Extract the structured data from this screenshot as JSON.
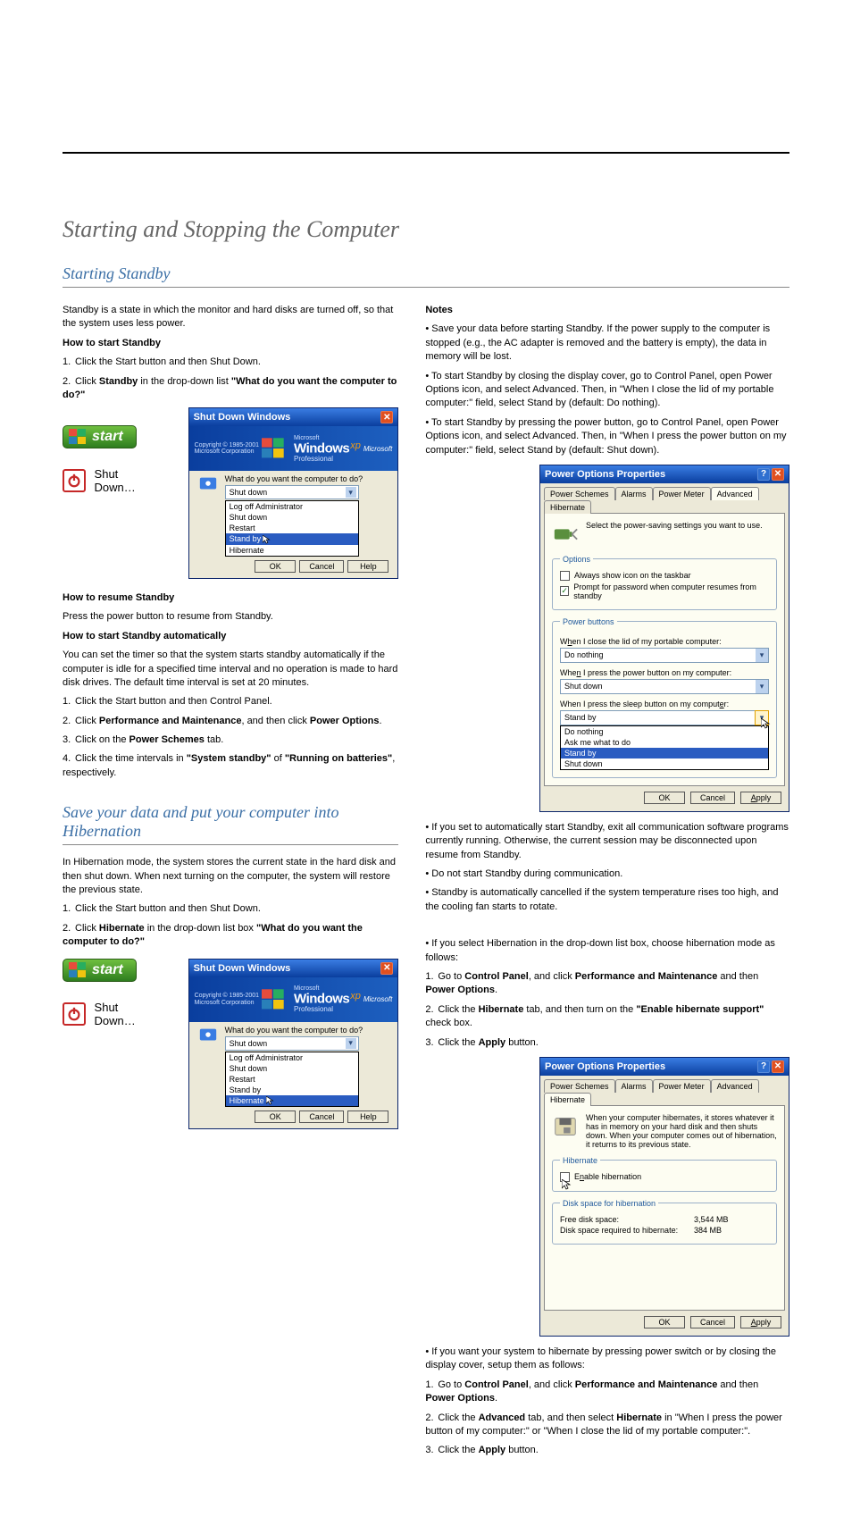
{
  "page": {
    "section_heading": "Starting and Stopping the Computer",
    "subtitle_standby": "Starting Standby",
    "subtitle_hibernate": "Save your data and put your computer into Hibernation"
  },
  "standby": {
    "intro": "Standby is a state in which the monitor and hard disks are turned off, so that the system uses less power.",
    "how_to_heading": "How to start Standby",
    "step1": "Click the Start button and then Shut Down.",
    "step2_a": "Click ",
    "step2_b": "Standby",
    "step2_c": " in the drop-down list ",
    "step2_d": "\"What do you want the computer to do?\"",
    "resume_heading": "How to resume Standby",
    "resume_body": "Press the power button to resume from Standby.",
    "auto_heading": "How to start Standby automatically",
    "auto_body": "You can set the timer so that the system starts standby automatically if the computer is idle for a specified time interval and no operation is made to hard disk drives. The default time interval is set at 20 minutes.",
    "auto_step1": "Click the Start button and then Control Panel.",
    "auto_step2_a": "Click ",
    "auto_step2_b": "Performance and Maintenance",
    "auto_step2_c": ", and then click ",
    "auto_step2_d": "Power Options",
    "auto_step2_e": ".",
    "auto_step3_a": "Click on the ",
    "auto_step3_b": "Power Schemes",
    "auto_step3_c": " tab.",
    "auto_step4_a": "Click the time intervals in ",
    "auto_step4_b": "\"System standby\"",
    "auto_step4_c": " of ",
    "auto_step4_d": "\"Running on batteries\"",
    "auto_step4_e": ", respectively.",
    "notes_heading": "Notes",
    "note1": "Save your data before starting Standby. If the power supply to the computer is stopped (e.g., the AC adapter is removed and the battery is empty), the data in memory will be lost.",
    "note2": "To start Standby by closing the display cover, go to Control Panel, open Power Options icon, and select Advanced. Then, in \"When I close the lid of my portable computer:\" field, select Stand by (default: Do nothing).",
    "note3": "To start Standby by pressing the power button, go to Control Panel, open Power Options icon, and select Advanced. Then, in \"When I press the power button on my computer:\" field, select Stand by (default: Shut down).",
    "note4": "If you set to automatically start Standby, exit all communication software programs currently running. Otherwise, the current session may be disconnected upon resume from Standby.",
    "note5": "Do not start Standby during communication.",
    "note6": "Standby is automatically cancelled if the system temperature rises too high, and the cooling fan starts to rotate."
  },
  "hibernate": {
    "intro": "In Hibernation mode, the system stores the current state in the hard disk and then shut down. When next turning on the computer, the system will restore the previous state.",
    "step1": "Click the Start button and then Shut Down.",
    "step2_a": "Click ",
    "step2_b": "Hibernate",
    "step2_c": " in the drop-down list box ",
    "step2_d": "\"What do you want the computer to do?\"",
    "notes_intro1": "If you select Hibernation in the drop-down list box, choose hibernation mode as follows:",
    "h_step1_a": "Go to ",
    "h_step1_b": "Control Panel",
    "h_step1_c": ", and click ",
    "h_step1_d": "Performance and Maintenance",
    "h_step1_e": " and then ",
    "h_step1_f": "Power Options",
    "h_step1_g": ".",
    "h_step2_a": "Click the ",
    "h_step2_b": "Hibernate",
    "h_step2_c": " tab, and then turn on the ",
    "h_step2_d": "\"Enable hibernate support\"",
    "h_step2_e": " check box.",
    "h_step3_a": "Click the ",
    "h_step3_b": "Apply",
    "h_step3_c": " button.",
    "notes_intro2": "If you want your system to hibernate by pressing power switch or by closing the display cover, setup them as follows:",
    "p_step1_a": "Go to ",
    "p_step1_b": "Control Panel",
    "p_step1_c": ", and click ",
    "p_step1_d": "Performance and Maintenance",
    "p_step1_e": " and then ",
    "p_step1_f": "Power Options",
    "p_step1_g": ".",
    "p_step2_a": "Click the ",
    "p_step2_b": "Advanced",
    "p_step2_c": " tab, and then select ",
    "p_step2_d": "Hibernate",
    "p_step2_e": " in \"When I press the power button of my computer:\" or \"When I close the lid of my portable computer:\".",
    "p_step3_a": "Click the ",
    "p_step3_b": "Apply",
    "p_step3_c": " button."
  },
  "start_label": "start",
  "shutdown_label": "Shut Down…",
  "shutdown_dialog": {
    "title": "Shut Down Windows",
    "copyright1": "Copyright © 1985-2001",
    "copyright2": "Microsoft Corporation",
    "brand_ms": "Microsoft",
    "brand_win": "Windows",
    "brand_ed": "Professional",
    "brand_xp": "xp",
    "ms_label": "Microsoft",
    "question": "What do you want the computer to do?",
    "selected": "Shut down",
    "options": [
      "Log off Administrator",
      "Shut down",
      "Restart",
      "Stand by",
      "Hibernate"
    ],
    "highlight_a": "Stand by",
    "highlight_b": "Hibernate",
    "btn_ok": "OK",
    "btn_cancel": "Cancel",
    "btn_help": "Help"
  },
  "power_options": {
    "title": "Power Options Properties",
    "tabs": [
      "Power Schemes",
      "Alarms",
      "Power Meter",
      "Advanced",
      "Hibernate"
    ],
    "advanced": {
      "desc": "Select the power-saving settings you want to use.",
      "legend_options": "Options",
      "opt1": "Always show icon on the taskbar",
      "opt2": "Prompt for password when computer resumes from standby",
      "legend_buttons": "Power buttons",
      "lid_label_pre": "W",
      "lid_label_u": "h",
      "lid_label_post": "en I close the lid of my portable computer:",
      "lid_value": "Do nothing",
      "pwr_label_pre": "Whe",
      "pwr_label_u": "n",
      "pwr_label_post": " I press the power button on my computer:",
      "pwr_value": "Shut down",
      "slp_label_pre": "When I press the sleep button on my comput",
      "slp_label_u": "e",
      "slp_label_post": "r:",
      "slp_value": "Stand by",
      "slp_options": [
        "Do nothing",
        "Ask me what to do",
        "Stand by",
        "Shut down"
      ]
    },
    "hibernate_tab": {
      "desc": "When your computer hibernates, it stores whatever it has in memory on your hard disk and then shuts down. When your computer comes out of hibernation, it returns to its previous state.",
      "legend_hib": "Hibernate",
      "enable_pre": "E",
      "enable_u": "n",
      "enable_post": "able hibernation",
      "legend_disk": "Disk space for hibernation",
      "free_k": "Free disk space:",
      "free_v": "3,544 MB",
      "req_k": "Disk space required to hibernate:",
      "req_v": "384 MB"
    },
    "btn_ok": "OK",
    "btn_cancel": "Cancel",
    "btn_apply_pre": "A",
    "btn_apply_post": "pply"
  }
}
